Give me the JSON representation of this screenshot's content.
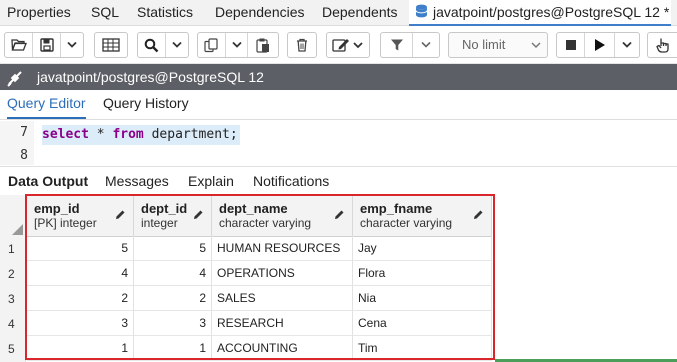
{
  "tabs": [
    {
      "label": "Properties"
    },
    {
      "label": "SQL"
    },
    {
      "label": "Statistics"
    },
    {
      "label": "Dependencies"
    },
    {
      "label": "Dependents"
    },
    {
      "label": "javatpoint/postgres@PostgreSQL 12 *",
      "icon": "database-icon"
    }
  ],
  "toolbar": {
    "limit_label": "No limit"
  },
  "connection": {
    "label": "javatpoint/postgres@PostgreSQL 12",
    "icon": "plug-icon"
  },
  "editor_tabs": [
    {
      "label": "Query Editor"
    },
    {
      "label": "Query History"
    }
  ],
  "code": {
    "lines": [
      {
        "number": "7",
        "keyword1": "select",
        "middle": " * ",
        "keyword2": "from",
        "rest": " department;"
      },
      {
        "number": "8"
      }
    ]
  },
  "output_tabs": [
    {
      "label": "Data Output"
    },
    {
      "label": "Messages"
    },
    {
      "label": "Explain"
    },
    {
      "label": "Notifications"
    }
  ],
  "grid": {
    "columns": [
      {
        "name": "emp_id",
        "type": "[PK] integer"
      },
      {
        "name": "dept_id",
        "type": "integer"
      },
      {
        "name": "dept_name",
        "type": "character varying"
      },
      {
        "name": "emp_fname",
        "type": "character varying"
      }
    ],
    "rows": [
      {
        "n": "1",
        "cells": [
          "5",
          "5",
          "HUMAN RESOURCES",
          "Jay"
        ]
      },
      {
        "n": "2",
        "cells": [
          "4",
          "4",
          "OPERATIONS",
          "Flora"
        ]
      },
      {
        "n": "3",
        "cells": [
          "2",
          "2",
          "SALES",
          "Nia"
        ]
      },
      {
        "n": "4",
        "cells": [
          "3",
          "3",
          "RESEARCH",
          "Cena"
        ]
      },
      {
        "n": "5",
        "cells": [
          "1",
          "1",
          "ACCOUNTING",
          "Tim"
        ]
      }
    ]
  },
  "colors": {
    "accent": "#2c6fb8",
    "highlight_box": "#d9262c",
    "connection_bar": "#5c5f65",
    "keyword": "#8b008b"
  }
}
